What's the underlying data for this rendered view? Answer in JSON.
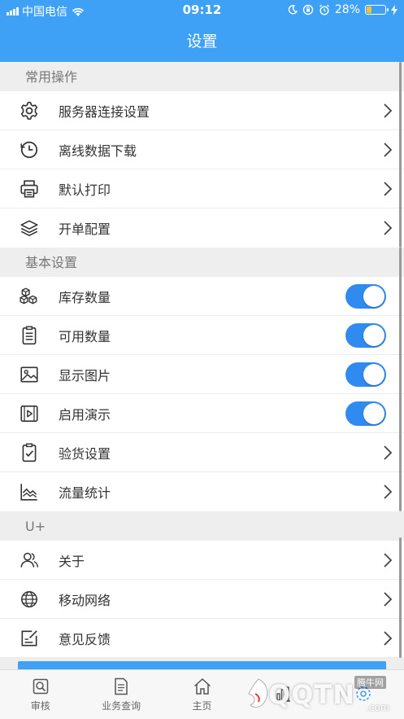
{
  "status_bar": {
    "carrier": "中国电信",
    "time": "09:12",
    "battery_percent": "28%",
    "battery_level": 0.28
  },
  "nav": {
    "title": "设置"
  },
  "sections": [
    {
      "header": "常用操作",
      "items": [
        {
          "label": "服务器连接设置",
          "icon": "gear-icon",
          "control": "chevron"
        },
        {
          "label": "离线数据下载",
          "icon": "clock-icon",
          "control": "chevron"
        },
        {
          "label": "默认打印",
          "icon": "printer-icon",
          "control": "chevron"
        },
        {
          "label": "开单配置",
          "icon": "layers-icon",
          "control": "chevron"
        }
      ]
    },
    {
      "header": "基本设置",
      "items": [
        {
          "label": "库存数量",
          "icon": "boxes-icon",
          "control": "toggle",
          "on": true
        },
        {
          "label": "可用数量",
          "icon": "clipboard-list-icon",
          "control": "toggle",
          "on": true
        },
        {
          "label": "显示图片",
          "icon": "image-icon",
          "control": "toggle",
          "on": true
        },
        {
          "label": "启用演示",
          "icon": "video-icon",
          "control": "toggle",
          "on": true
        },
        {
          "label": "验货设置",
          "icon": "clipboard-check-icon",
          "control": "chevron"
        },
        {
          "label": "流量统计",
          "icon": "line-chart-icon",
          "control": "chevron"
        }
      ]
    },
    {
      "header": "U+",
      "items": [
        {
          "label": "关于",
          "icon": "users-icon",
          "control": "chevron"
        },
        {
          "label": "移动网络",
          "icon": "globe-icon",
          "control": "chevron"
        },
        {
          "label": "意见反馈",
          "icon": "feedback-icon",
          "control": "chevron"
        }
      ]
    }
  ],
  "tabs": [
    {
      "label": "审核",
      "icon": "audit-icon"
    },
    {
      "label": "业务查询",
      "icon": "document-icon"
    },
    {
      "label": "主页",
      "icon": "home-icon"
    },
    {
      "label": "",
      "icon": "chart-icon"
    },
    {
      "label": "",
      "icon": "settings-tab-icon"
    }
  ],
  "watermark": {
    "text": "QQTN",
    "sub": "腾牛网",
    "suffix": ".com"
  },
  "colors": {
    "accent": "#3fa1f5",
    "toggle_on": "#2f8bf0"
  }
}
